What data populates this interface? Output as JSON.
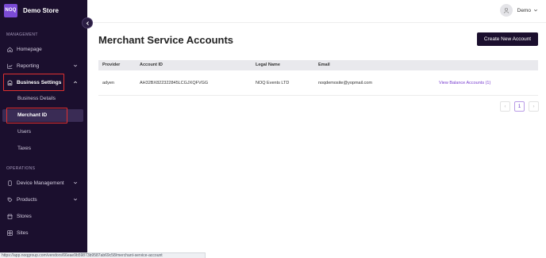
{
  "brand": {
    "logo_text": "NOQ",
    "name": "Demo Store"
  },
  "sidebar": {
    "management_title": "MANAGEMENT",
    "operations_title": "OPERATIONS",
    "items": {
      "homepage": "Homepage",
      "reporting": "Reporting",
      "business_settings": "Business Settings",
      "business_details": "Business Details",
      "merchant_id": "Merchant ID",
      "users": "Users",
      "taxes": "Taxes",
      "device_management": "Device Management",
      "products": "Products",
      "stores": "Stores",
      "sites": "Sites"
    }
  },
  "header": {
    "user_name": "Demo"
  },
  "page": {
    "title": "Merchant Service Accounts",
    "create_button": "Create New Account"
  },
  "table": {
    "columns": {
      "provider": "Provider",
      "account_id": "Account ID",
      "legal_name": "Legal Name",
      "email": "Email"
    },
    "rows": [
      {
        "provider": "adyen",
        "account_id": "AH32BX822322845LCGJXQFVGG",
        "legal_name": "NOQ Events LTD",
        "email": "noqdemosite@yopmail.com",
        "action": "View Balance Accounts (1)"
      }
    ]
  },
  "pagination": {
    "prev": "‹",
    "current": "1",
    "next": "›"
  },
  "status_bar": {
    "url": "https://app.noqgroup.com/vendors/66eae9b59873b9587ab69c58/merchant-service-account"
  },
  "colors": {
    "sidebar_bg": "#1b0f2e",
    "accent": "#7b4bd6",
    "link": "#7a3fd0",
    "highlight_border": "#e03030"
  }
}
